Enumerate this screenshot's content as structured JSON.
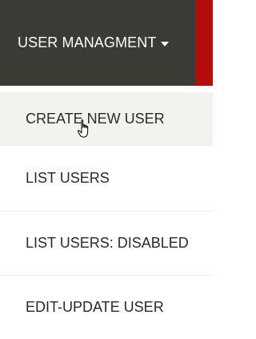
{
  "nav": {
    "toggle_label": "USER MANAGMENT",
    "caret_icon": "caret-down-icon",
    "colors": {
      "bar": "#3a3b35",
      "accent": "#b30d0d",
      "hover": "#f4f2ef"
    }
  },
  "menu": {
    "items": [
      {
        "label": "CREATE NEW USER"
      },
      {
        "label": "LIST USERS"
      },
      {
        "label": "LIST USERS: DISABLED"
      },
      {
        "label": "EDIT-UPDATE USER"
      }
    ]
  },
  "pointer": {
    "icon": "hand-pointer-cursor-icon"
  }
}
